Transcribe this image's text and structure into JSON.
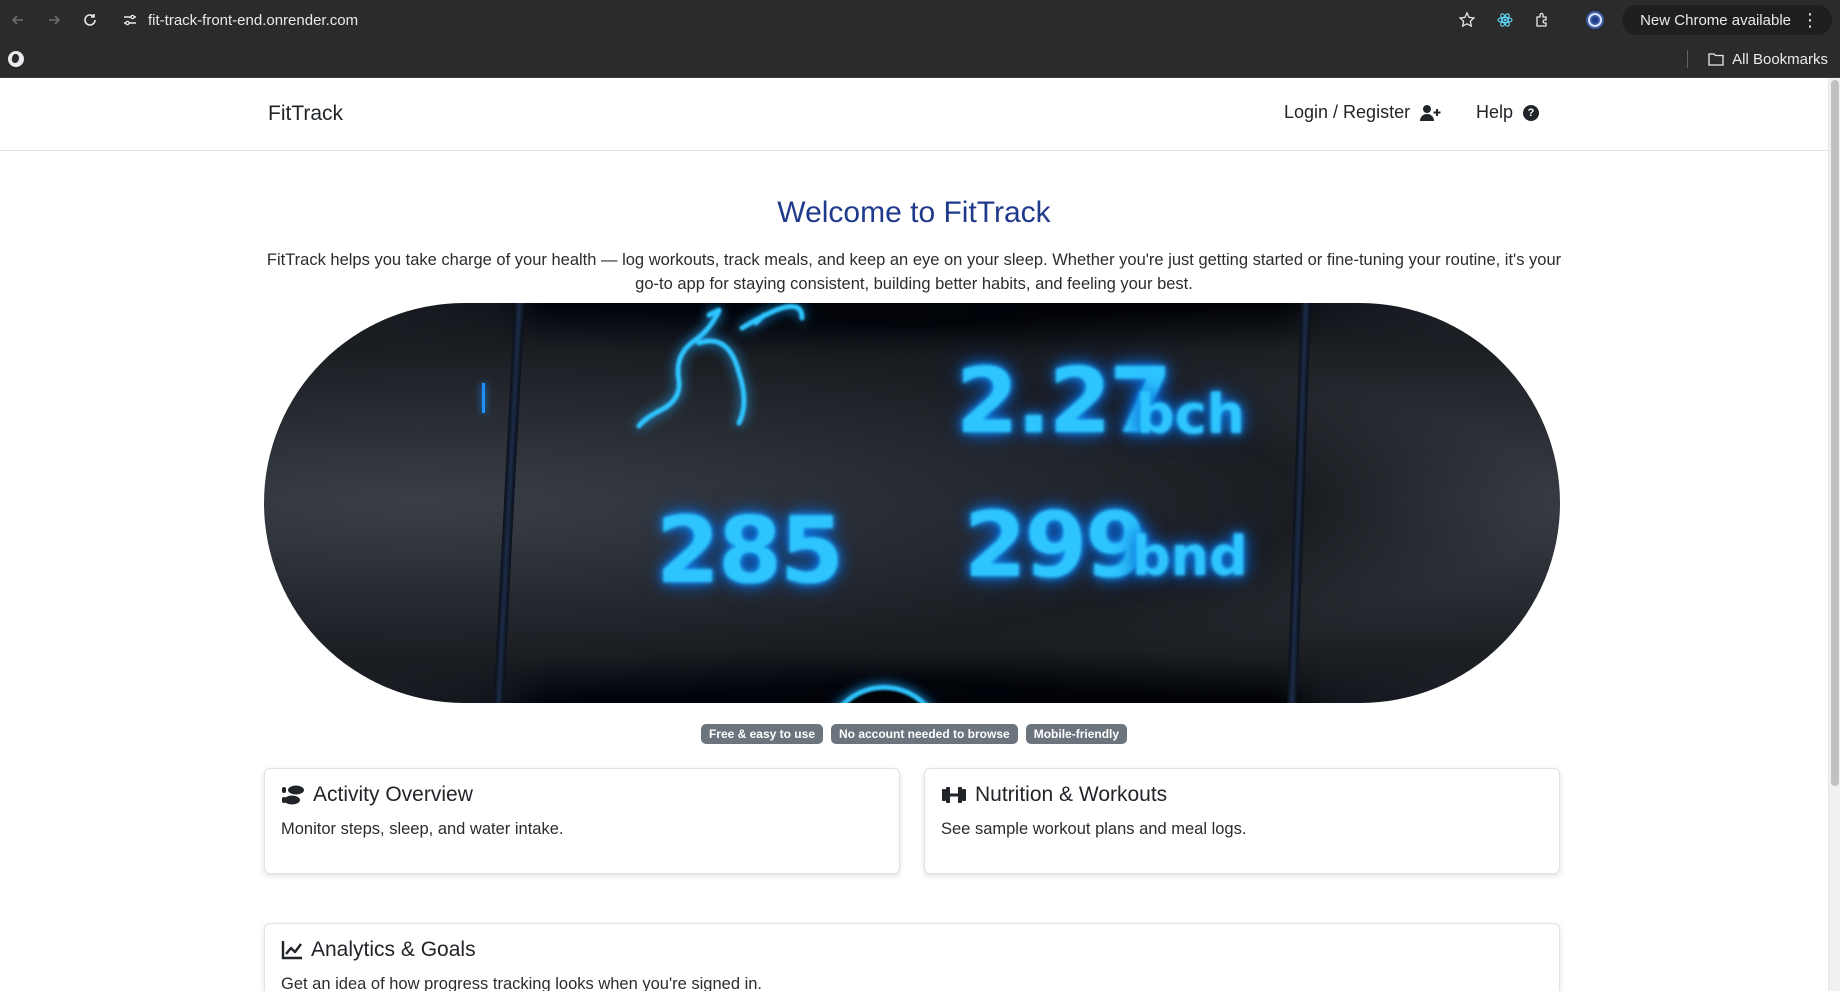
{
  "browser": {
    "url": "fit-track-front-end.onrender.com",
    "update_label": "New Chrome available",
    "bookmarks_label": "All Bookmarks"
  },
  "navbar": {
    "brand": "FitTrack",
    "login_label": "Login / Register",
    "help_label": "Help"
  },
  "hero": {
    "title": "Welcome to FitTrack",
    "description": "FitTrack helps you take charge of your health — log workouts, track meals, and keep an eye on your sleep. Whether you're just getting started or fine-tuning your routine, it's your go-to app for staying consistent, building better habits, and feeling your best.",
    "image_readouts": [
      "2.27",
      "bch",
      "285",
      "299",
      "bnd"
    ]
  },
  "badges": [
    "Free & easy to use",
    "No account needed to browse",
    "Mobile-friendly"
  ],
  "cards": [
    {
      "title": "Activity Overview",
      "text": "Monitor steps, sleep, and water intake.",
      "icon": "shoe-prints-icon"
    },
    {
      "title": "Nutrition & Workouts",
      "text": "See sample workout plans and meal logs.",
      "icon": "dumbbell-icon"
    },
    {
      "title": "Analytics & Goals",
      "text": "Get an idea of how progress tracking looks when you're signed in.",
      "icon": "line-chart-icon"
    }
  ],
  "colors": {
    "title_blue": "#1f3a8a",
    "badge_gray": "#6c757d",
    "chrome_dark": "#2b2b2b",
    "glow_cyan": "#2ec5ff"
  }
}
